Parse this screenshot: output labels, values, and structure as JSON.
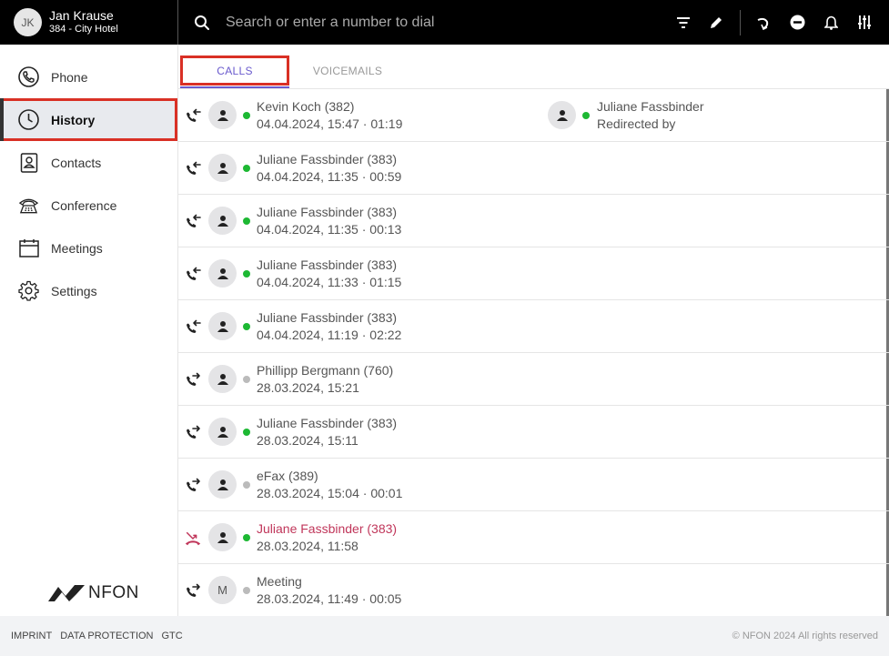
{
  "user": {
    "initials": "JK",
    "name": "Jan Krause",
    "subtitle": "384 - City Hotel"
  },
  "search": {
    "placeholder": "Search or enter a number to dial"
  },
  "top_icons": [
    "filter-icon",
    "pencil-icon",
    "call-back-icon",
    "do-not-disturb-icon",
    "bell-icon",
    "sliders-icon"
  ],
  "sidebar": {
    "items": [
      {
        "label": "Phone",
        "icon": "phone-icon"
      },
      {
        "label": "History",
        "icon": "clock-icon"
      },
      {
        "label": "Contacts",
        "icon": "contact-card-icon"
      },
      {
        "label": "Conference",
        "icon": "conference-phone-icon"
      },
      {
        "label": "Meetings",
        "icon": "calendar-icon"
      },
      {
        "label": "Settings",
        "icon": "gear-icon"
      }
    ],
    "active": "History",
    "logo": "NFON"
  },
  "tabs": {
    "calls": "CALLS",
    "voicemails": "VOICEMAILS"
  },
  "calls": [
    {
      "name": "Kevin Koch (382)",
      "meta": "04.04.2024, 15:47 · 01:19",
      "direction": "incoming",
      "status": "green",
      "redirect": {
        "name": "Juliane Fassbinder",
        "label": "Redirected by"
      }
    },
    {
      "name": "Juliane Fassbinder (383)",
      "meta": "04.04.2024, 11:35 · 00:59",
      "direction": "incoming",
      "status": "green"
    },
    {
      "name": "Juliane Fassbinder (383)",
      "meta": "04.04.2024, 11:35 · 00:13",
      "direction": "incoming",
      "status": "green"
    },
    {
      "name": "Juliane Fassbinder (383)",
      "meta": "04.04.2024, 11:33 · 01:15",
      "direction": "incoming",
      "status": "green"
    },
    {
      "name": "Juliane Fassbinder (383)",
      "meta": "04.04.2024, 11:19 · 02:22",
      "direction": "incoming",
      "status": "green"
    },
    {
      "name": "Phillipp Bergmann (760)",
      "meta": "28.03.2024, 15:21",
      "direction": "outgoing",
      "status": "grey"
    },
    {
      "name": "Juliane Fassbinder (383)",
      "meta": "28.03.2024, 15:11",
      "direction": "outgoing",
      "status": "green"
    },
    {
      "name": "eFax (389)",
      "meta": "28.03.2024, 15:04 · 00:01",
      "direction": "outgoing",
      "status": "grey"
    },
    {
      "name": "Juliane Fassbinder (383)",
      "meta": "28.03.2024, 11:58",
      "direction": "missed",
      "status": "green"
    },
    {
      "name": "Meeting",
      "meta": "28.03.2024, 11:49 · 00:05",
      "direction": "outgoing",
      "status": "grey",
      "avatar_text": "M"
    }
  ],
  "footer": {
    "imprint": "IMPRINT",
    "data_protection": "DATA PROTECTION",
    "gtc": "GTC",
    "copyright": "© NFON 2024 All rights reserved"
  },
  "colors": {
    "accent": "#6a5acd",
    "highlight_border": "#d93025",
    "online": "#1db833",
    "missed": "#c0365a"
  }
}
